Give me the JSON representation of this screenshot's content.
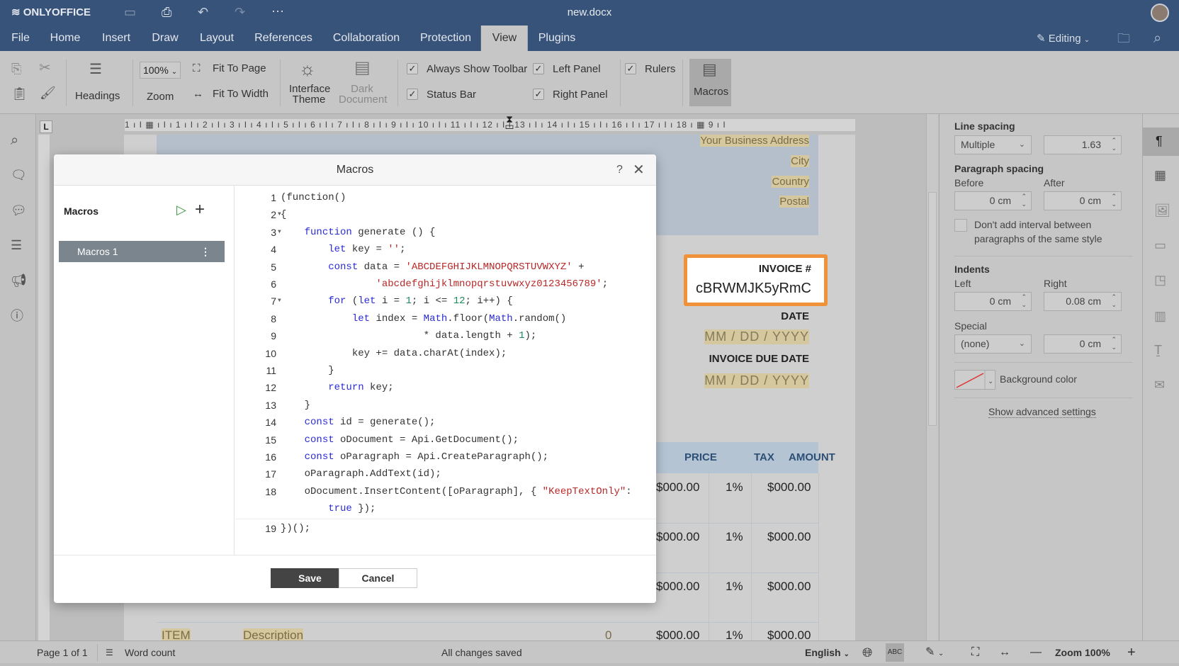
{
  "app": {
    "logo": "ONLYOFFICE",
    "title": "new.docx",
    "mode": "Editing"
  },
  "menu": [
    "File",
    "Home",
    "Insert",
    "Draw",
    "Layout",
    "References",
    "Collaboration",
    "Protection",
    "View",
    "Plugins"
  ],
  "menu_active": "View",
  "toolbar": {
    "headings": "Headings",
    "zoom_value": "100%",
    "zoom_label": "Zoom",
    "fit_page": "Fit To Page",
    "fit_width": "Fit To Width",
    "interface_theme": "Interface Theme",
    "dark_document": "Dark Document",
    "always_show_toolbar": "Always Show Toolbar",
    "status_bar": "Status Bar",
    "left_panel": "Left Panel",
    "right_panel": "Right Panel",
    "rulers": "Rulers",
    "macros": "Macros",
    "checks": {
      "always_show_toolbar": true,
      "status_bar": true,
      "left_panel": true,
      "right_panel": true,
      "rulers": true
    }
  },
  "ruler": "1 ı I ▦ ı I ı 1 ı I ı 2 ı I ı 3 ı I ı 4 ı I ı 5 ı I ı 6 ı I ı 7 ı I ı 8 ı I ı 9 ı I ı 10 ı I ı 11 ı I ı 12 ı I ı 13 ı I ı 14 ı I ı 15 ı I ı 16 ı I ı 17 ı I ı 18 ı ▦ 9 ı I",
  "document": {
    "address": [
      "Your Business Address",
      "City",
      "Country",
      "Postal"
    ],
    "invoice_label": "INVOICE #",
    "invoice_id": "cBRWMJK5yRmC",
    "date_label": "DATE",
    "date_value": "MM / DD / YYYY",
    "due_label": "INVOICE DUE DATE",
    "due_value": "MM / DD / YYYY",
    "table_headers": [
      "PRICE",
      "TAX",
      "AMOUNT"
    ],
    "rows": [
      {
        "price": "$000.00",
        "tax": "1%",
        "amount": "$000.00"
      },
      {
        "price": "$000.00",
        "tax": "1%",
        "amount": "$000.00"
      },
      {
        "price": "$000.00",
        "tax": "1%",
        "amount": "$000.00"
      },
      {
        "item": "ITEM",
        "description": "Description",
        "qty": "0",
        "price": "$000.00",
        "tax": "1%",
        "amount": "$000.00"
      }
    ]
  },
  "right_panel": {
    "line_spacing": "Line spacing",
    "line_mode": "Multiple",
    "line_value": "1.63",
    "paragraph_spacing": "Paragraph spacing",
    "before": "Before",
    "after": "After",
    "before_value": "0 cm",
    "after_value": "0 cm",
    "dont_add": "Don't add interval between",
    "dont_add2": "paragraphs of the same style",
    "indents": "Indents",
    "left": "Left",
    "right": "Right",
    "left_value": "0 cm",
    "right_value": "0.08 cm",
    "special": "Special",
    "special_mode": "(none)",
    "special_value": "0 cm",
    "background_color": "Background color",
    "advanced": "Show advanced settings"
  },
  "status": {
    "page": "Page 1 of 1",
    "word_count": "Word count",
    "saved": "All changes saved",
    "language": "English",
    "zoom": "Zoom 100%"
  },
  "dialog": {
    "title": "Macros",
    "help": "?",
    "list_title": "Macros",
    "macros": [
      "Macros 1"
    ],
    "save": "Save",
    "cancel": "Cancel",
    "code": [
      {
        "n": "1",
        "t": [
          [
            "p",
            "(function()"
          ]
        ]
      },
      {
        "n": "2",
        "f": 1,
        "t": [
          [
            "p",
            "{"
          ]
        ]
      },
      {
        "n": "3",
        "f": 1,
        "t": [
          [
            "p",
            "    "
          ],
          [
            "k",
            "function"
          ],
          [
            "p",
            " generate () {"
          ]
        ]
      },
      {
        "n": "4",
        "t": [
          [
            "p",
            "        "
          ],
          [
            "k",
            "let"
          ],
          [
            "p",
            " key = "
          ],
          [
            "s",
            "''"
          ],
          [
            "p",
            ";"
          ]
        ]
      },
      {
        "n": "5",
        "t": [
          [
            "p",
            "        "
          ],
          [
            "k",
            "const"
          ],
          [
            "p",
            " data = "
          ],
          [
            "s",
            "'ABCDEFGHIJKLMNOPQRSTUVWXYZ'"
          ],
          [
            "p",
            " +"
          ]
        ]
      },
      {
        "n": "6",
        "t": [
          [
            "p",
            "                "
          ],
          [
            "s",
            "'abcdefghijklmnopqrstuvwxyz0123456789'"
          ],
          [
            "p",
            ";"
          ]
        ]
      },
      {
        "n": "7",
        "f": 1,
        "t": [
          [
            "p",
            "        "
          ],
          [
            "k",
            "for"
          ],
          [
            "p",
            " ("
          ],
          [
            "k",
            "let"
          ],
          [
            "p",
            " i = "
          ],
          [
            "n",
            "1"
          ],
          [
            "p",
            "; i <= "
          ],
          [
            "n",
            "12"
          ],
          [
            "p",
            "; i++) {"
          ]
        ]
      },
      {
        "n": "8",
        "t": [
          [
            "p",
            "            "
          ],
          [
            "k",
            "let"
          ],
          [
            "p",
            " index = "
          ],
          [
            "b",
            "Math"
          ],
          [
            "p",
            ".floor("
          ],
          [
            "b",
            "Math"
          ],
          [
            "p",
            ".random()"
          ]
        ]
      },
      {
        "n": "9",
        "t": [
          [
            "p",
            "                        * data.length + "
          ],
          [
            "n",
            "1"
          ],
          [
            "p",
            ");"
          ]
        ]
      },
      {
        "n": "10",
        "t": [
          [
            "p",
            "            key += data.charAt(index);"
          ]
        ]
      },
      {
        "n": "11",
        "t": [
          [
            "p",
            "        }"
          ]
        ]
      },
      {
        "n": "12",
        "t": [
          [
            "p",
            "        "
          ],
          [
            "k",
            "return"
          ],
          [
            "p",
            " key;"
          ]
        ]
      },
      {
        "n": "13",
        "t": [
          [
            "p",
            "    }"
          ]
        ]
      },
      {
        "n": "14",
        "t": [
          [
            "p",
            "    "
          ],
          [
            "k",
            "const"
          ],
          [
            "p",
            " id = generate();"
          ]
        ]
      },
      {
        "n": "15",
        "t": [
          [
            "p",
            "    "
          ],
          [
            "k",
            "const"
          ],
          [
            "p",
            " oDocument = Api.GetDocument();"
          ]
        ]
      },
      {
        "n": "16",
        "t": [
          [
            "p",
            "    "
          ],
          [
            "k",
            "const"
          ],
          [
            "p",
            " oParagraph = Api.CreateParagraph();"
          ]
        ]
      },
      {
        "n": "17",
        "t": [
          [
            "p",
            "    oParagraph.AddText(id);"
          ]
        ]
      },
      {
        "n": "18",
        "t": [
          [
            "p",
            "    oDocument.InsertContent([oParagraph], { "
          ],
          [
            "s",
            "\"KeepTextOnly\""
          ],
          [
            "p",
            ":"
          ]
        ]
      },
      {
        "n": "",
        "t": [
          [
            "p",
            "        "
          ],
          [
            "k",
            "true"
          ],
          [
            "p",
            " });"
          ]
        ]
      },
      {
        "n": "19",
        "t": [
          [
            "p",
            "})();"
          ]
        ]
      }
    ]
  },
  "colors": {
    "header": "#37537a",
    "accent_orange": "#f0923a",
    "field_highlight": "#d6c89e",
    "save_button": "#444444"
  }
}
